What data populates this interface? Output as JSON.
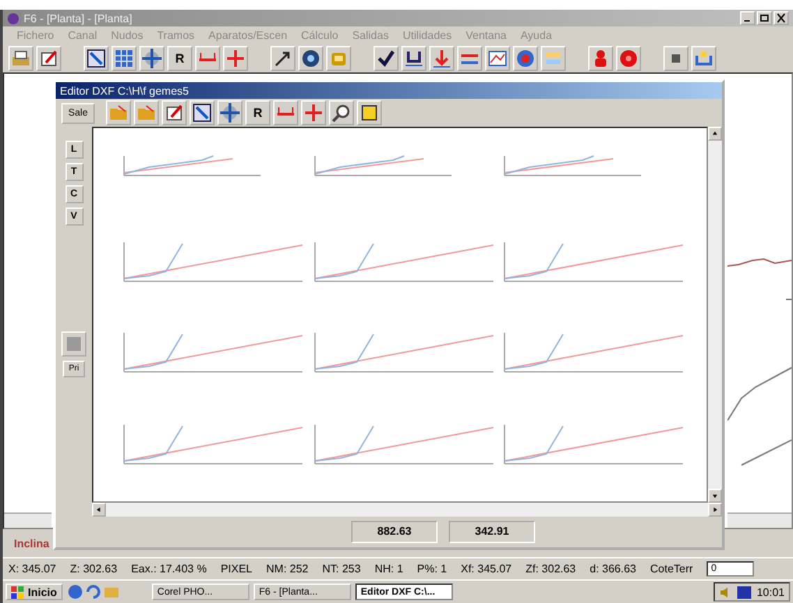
{
  "window": {
    "title": "F6 - [Planta] - [Planta]"
  },
  "menu": [
    "Fichero",
    "Canal",
    "Nudos",
    "Tramos",
    "Aparatos/Escen",
    "Cálculo",
    "Salidas",
    "Utilidades",
    "Ventana",
    "Ayuda"
  ],
  "toolbar": {
    "letter": "R"
  },
  "editor": {
    "title": "Editor DXF C:\\H\\f gemes5",
    "exit_button": "Sale",
    "toolbar_letter": "R",
    "side_buttons": [
      "L",
      "T",
      "C",
      "V"
    ],
    "print_button": "Pri",
    "plots": [
      {
        "kind": "flat"
      },
      {
        "kind": "flat"
      },
      {
        "kind": "flat"
      },
      {
        "kind": "bent"
      },
      {
        "kind": "bent"
      },
      {
        "kind": "bent"
      },
      {
        "kind": "bent"
      },
      {
        "kind": "bent"
      },
      {
        "kind": "bent"
      },
      {
        "kind": "bent"
      },
      {
        "kind": "bent"
      },
      {
        "kind": "bent"
      }
    ],
    "values": [
      "882.63",
      "342.91"
    ]
  },
  "side_label": "Inclina",
  "status_bar": {
    "items": [
      "X: 345.07",
      "Z: 302.63",
      "Eax.: 17.403 %",
      "PIXEL",
      "NM: 252",
      "NT: 253",
      "NH: 1",
      "P%: 1",
      "Xf: 345.07",
      "Zf: 302.63",
      "d: 366.63",
      "CoteTerr"
    ],
    "input_value": "0"
  },
  "taskbar": {
    "start": "Inicio",
    "tasks": [
      {
        "label": "Corel PHO...",
        "selected": false
      },
      {
        "label": "F6 - [Planta...",
        "selected": false
      },
      {
        "label": "Editor DXF C:\\...",
        "selected": true
      }
    ],
    "clock": "10:01"
  }
}
